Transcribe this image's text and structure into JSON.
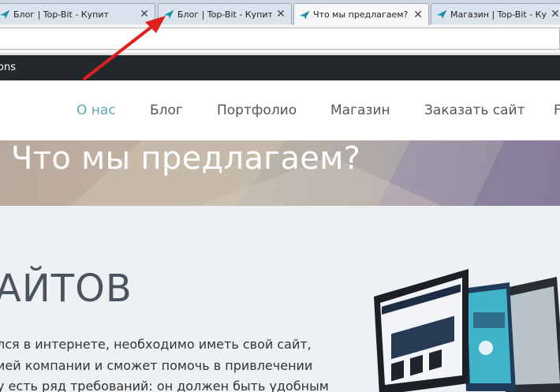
{
  "browser": {
    "tabs": [
      {
        "title": "Блог | Top-Bit - Купит",
        "close": "✕",
        "active": false
      },
      {
        "title": "Блог | Top-Bit - Купит",
        "close": "✕",
        "active": false
      },
      {
        "title": "Что мы предлагаем? |",
        "close": "✕",
        "active": true
      },
      {
        "title": "Магазин | Top-Bit - Ку",
        "close": "✕",
        "active": false
      }
    ],
    "favicon_icon": "paper-plane-icon",
    "bookmarks_bar_text": "ons"
  },
  "site_nav": {
    "items": [
      {
        "label": "О нас",
        "current": true
      },
      {
        "label": "Блог",
        "current": false
      },
      {
        "label": "Портфолио",
        "current": false
      },
      {
        "label": "Магазин",
        "current": false
      },
      {
        "label": "Заказать сайт",
        "current": false
      },
      {
        "label": "F",
        "current": false
      }
    ]
  },
  "hero": {
    "title": "Что мы предлагаем?"
  },
  "content": {
    "heading": "АЙТОВ",
    "paragraph_lines": [
      "лся в интернете, необходимо иметь свой сайт,",
      "ией компании и сможет помочь в привлечении",
      "у есть ряд требований: он должен быть удобным"
    ]
  },
  "annotation": {
    "arrow_color": "#e0201c"
  },
  "colors": {
    "nav_active": "#5da7b5",
    "dark_bar": "#23282d",
    "favicon": "#1f9bb0"
  }
}
